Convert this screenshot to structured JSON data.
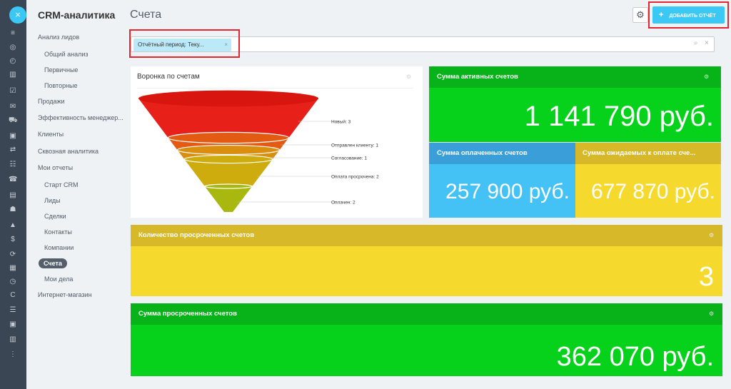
{
  "sidebar": {
    "close_icon": "×",
    "icons": [
      "filter-icon",
      "target-icon",
      "clock-icon",
      "chart-icon",
      "tasks-icon",
      "mail-icon",
      "cart-icon",
      "calendar-icon",
      "sliders-icon",
      "contacts-icon",
      "phone-icon",
      "chat-icon",
      "group-icon",
      "sites-icon",
      "dollar-icon",
      "sync-icon",
      "disk-icon",
      "history-icon",
      "code-icon",
      "list-icon",
      "robot-icon",
      "settings-icon",
      "more-icon"
    ],
    "glyphs": [
      "≡",
      "◎",
      "◴",
      "▥",
      "☑",
      "✉",
      "⛟",
      "▣",
      "⇄",
      "☷",
      "☎",
      "▤",
      "☗",
      "▲",
      "$",
      "⟳",
      "▦",
      "◷",
      "C",
      "☰",
      "▣",
      "▥",
      "⋮"
    ]
  },
  "menu": {
    "title": "CRM-аналитика",
    "items": [
      {
        "label": "Анализ лидов",
        "kind": "top"
      },
      {
        "label": "Общий анализ",
        "kind": "sub"
      },
      {
        "label": "Первичные",
        "kind": "sub"
      },
      {
        "label": "Повторные",
        "kind": "sub"
      },
      {
        "label": "Продажи",
        "kind": "top"
      },
      {
        "label": "Эффективность менеджер...",
        "kind": "top"
      },
      {
        "label": "Клиенты",
        "kind": "top"
      },
      {
        "label": "Сквозная аналитика",
        "kind": "top"
      },
      {
        "label": "Мои отчеты",
        "kind": "top"
      },
      {
        "label": "Старт CRM",
        "kind": "sub"
      },
      {
        "label": "Лиды",
        "kind": "sub"
      },
      {
        "label": "Сделки",
        "kind": "sub"
      },
      {
        "label": "Контакты",
        "kind": "sub"
      },
      {
        "label": "Компании",
        "kind": "sub"
      },
      {
        "label": "Счета",
        "kind": "active"
      },
      {
        "label": "Мои дела",
        "kind": "sub"
      },
      {
        "label": "Интернет-магазин",
        "kind": "top"
      }
    ]
  },
  "header": {
    "title": "Счета",
    "settings_icon": "⚙",
    "add_button": "ДОБАВИТЬ ОТЧЁТ",
    "add_plus": "+"
  },
  "filter": {
    "chip_label": "Отчётный период: Теку...",
    "chip_remove": "×",
    "search_icon": "⌕",
    "clear_icon": "×"
  },
  "funnel": {
    "title": "Воронка по счетам",
    "stages": [
      {
        "label": "Новый: 3",
        "value": 3,
        "color": "#e8201a"
      },
      {
        "label": "Отправлен клиенту: 1",
        "value": 1,
        "color": "#e35a12"
      },
      {
        "label": "Согласование: 1",
        "value": 1,
        "color": "#d98e10"
      },
      {
        "label": "Оплата просрочена: 2",
        "value": 2,
        "color": "#cfac0e"
      },
      {
        "label": "Оплачен: 2",
        "value": 2,
        "color": "#a9b80f"
      }
    ]
  },
  "tiles": {
    "active": {
      "title": "Сумма активных счетов",
      "value": "1 141 790 руб.",
      "color": "#06d21b",
      "head_color": "#08b31a"
    },
    "paid": {
      "title": "Сумма оплаченных счетов",
      "value": "257 900 руб.",
      "color": "#45c2f5",
      "head_color": "#3a9fd8"
    },
    "expected": {
      "title": "Сумма ожидаемых к оплате сче...",
      "value": "677 870 руб.",
      "color": "#f6d92d",
      "head_color": "#d6b829"
    },
    "overdue_count": {
      "title": "Количество просроченных счетов",
      "value": "3",
      "color": "#f6d92d",
      "head_color": "#d6b829"
    },
    "overdue_sum": {
      "title": "Сумма просроченных счетов",
      "value": "362 070 руб.",
      "color": "#06d21b",
      "head_color": "#08b31a"
    }
  }
}
